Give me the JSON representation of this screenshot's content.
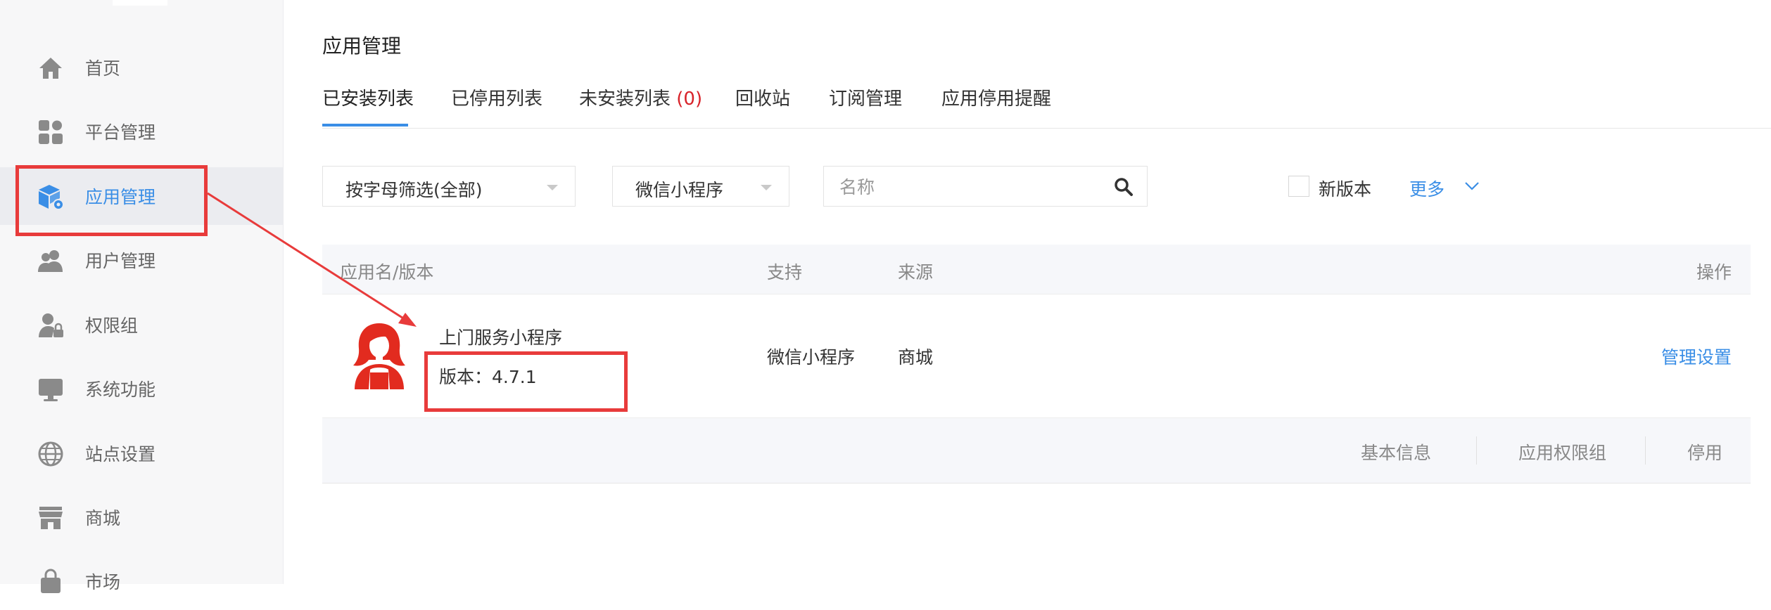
{
  "sidebar": {
    "items": [
      {
        "label": "首页",
        "icon": "home-icon"
      },
      {
        "label": "平台管理",
        "icon": "platform-grid-icon"
      },
      {
        "label": "应用管理",
        "icon": "app-cube-icon",
        "active": true
      },
      {
        "label": "用户管理",
        "icon": "users-icon"
      },
      {
        "label": "权限组",
        "icon": "user-lock-icon"
      },
      {
        "label": "系统功能",
        "icon": "monitor-icon"
      },
      {
        "label": "站点设置",
        "icon": "globe-icon"
      },
      {
        "label": "商城",
        "icon": "store-icon"
      },
      {
        "label": "市场",
        "icon": "bag-icon"
      }
    ]
  },
  "main": {
    "title": "应用管理",
    "tabs": [
      {
        "label": "已安装列表",
        "active": true
      },
      {
        "label": "已停用列表"
      },
      {
        "label": "未安装列表",
        "count": "(0)"
      },
      {
        "label": "回收站"
      },
      {
        "label": "订阅管理"
      },
      {
        "label": "应用停用提醒"
      }
    ],
    "filters": {
      "letter_filter": "按字母筛选(全部)",
      "platform_filter": "微信小程序",
      "search_placeholder": "名称",
      "new_version_label": "新版本",
      "more_label": "更多"
    },
    "table": {
      "headers": {
        "name": "应用名/版本",
        "support": "支持",
        "source": "来源",
        "actions": "操作"
      },
      "rows": [
        {
          "name": "上门服务小程序",
          "version": "版本：4.7.1",
          "support": "微信小程序",
          "source": "商城",
          "manage": "管理设置",
          "sub_actions": [
            "基本信息",
            "应用权限组",
            "停用"
          ]
        }
      ]
    }
  },
  "colors": {
    "accent": "#3a8ee6",
    "annotation": "#e83b3b",
    "count": "#d8232a",
    "avatar": "#e22b1f"
  }
}
